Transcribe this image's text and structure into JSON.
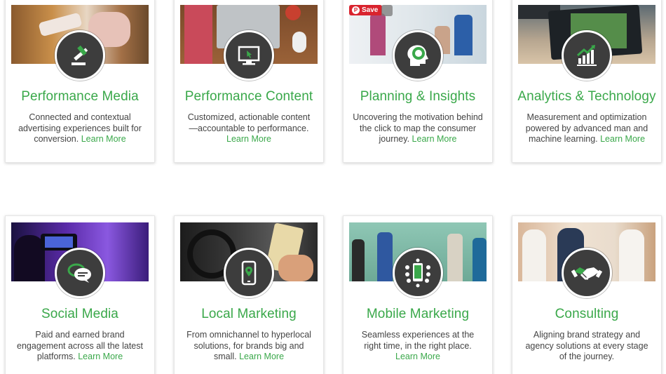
{
  "pin": {
    "save_label": "Save"
  },
  "cards": [
    {
      "title": "Performance Media",
      "desc": "Connected and contextual advertising experiences built for conversion.",
      "link": "Learn More",
      "icon": "gavel-icon"
    },
    {
      "title": "Performance Content",
      "desc": "Customized, actionable content —accountable to performance.",
      "link": "Learn More",
      "icon": "monitor-cursor-icon"
    },
    {
      "title": "Planning & Insights",
      "desc": "Uncovering the motivation behind the click to map the consumer journey.",
      "link": "Learn More",
      "icon": "head-chart-icon"
    },
    {
      "title": "Analytics & Technology",
      "desc": "Measurement and optimization powered by advanced man and machine learning.",
      "link": "Learn More",
      "icon": "bar-chart-icon"
    },
    {
      "title": "Social Media",
      "desc": "Paid and earned brand engagement across all the latest platforms.",
      "link": "Learn More",
      "icon": "chat-bubbles-icon"
    },
    {
      "title": "Local Marketing",
      "desc": "From omnichannel to hyperlocal solutions, for brands big and small.",
      "link": "Learn More",
      "icon": "phone-map-pin-icon"
    },
    {
      "title": "Mobile Marketing",
      "desc": "Seamless experiences at the right time, in the right place.",
      "link": "Learn More",
      "icon": "mobile-apps-icon"
    },
    {
      "title": "Consulting",
      "desc": "Aligning brand strategy and agency solutions at every stage of the journey.",
      "link": "",
      "icon": "handshake-icon"
    }
  ],
  "colors": {
    "accent_green": "#3aa84a",
    "badge_dark": "#3d3d3d",
    "pin_red": "#d9232e"
  }
}
